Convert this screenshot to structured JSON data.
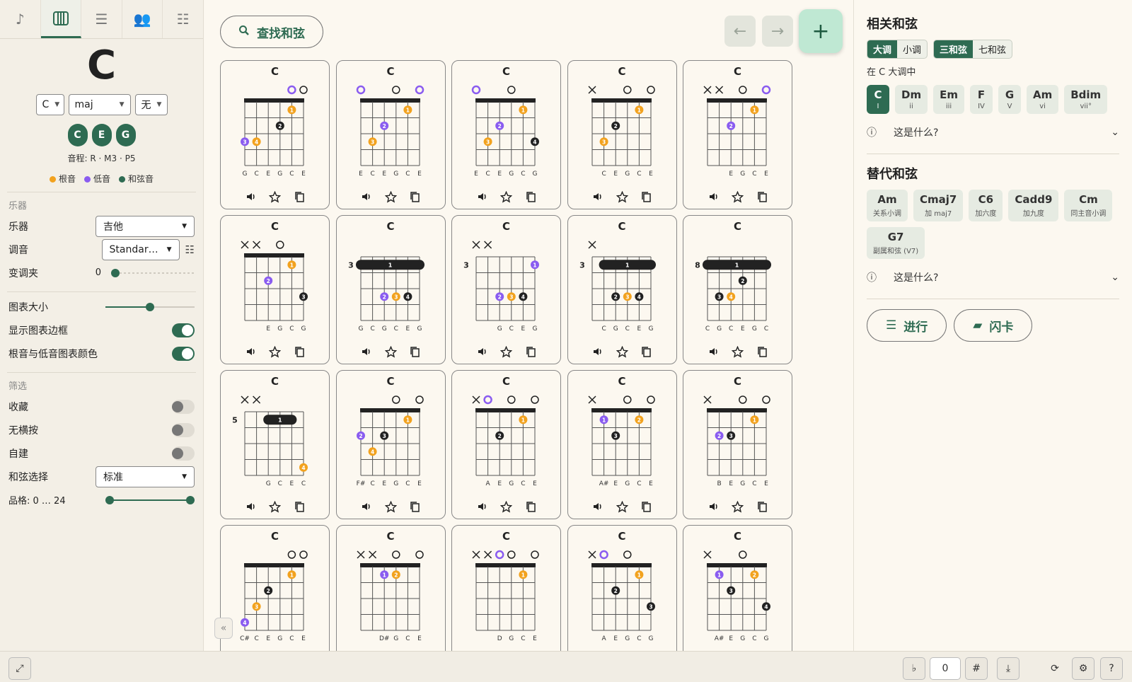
{
  "left": {
    "nav_tabs": [
      {
        "name": "note-icon"
      },
      {
        "name": "piano-icon"
      },
      {
        "name": "playlist-icon"
      },
      {
        "name": "people-icon"
      },
      {
        "name": "sliders-icon"
      }
    ],
    "chord_name": "C",
    "selectors": {
      "root": "C",
      "quality": "maj",
      "bass": "无"
    },
    "notes": [
      "C",
      "E",
      "G"
    ],
    "intervals": "音程: R · M3 · P5",
    "legend": {
      "root": "根音",
      "bass": "低音",
      "chord": "和弦音"
    },
    "instrument_section": "乐器",
    "instrument_label": "乐器",
    "instrument_value": "吉他",
    "tuning_label": "调音",
    "tuning_value": "Standar…",
    "capo_label": "变调夹",
    "capo_value": "0",
    "chart_size_label": "图表大小",
    "chart_size_level": 0.5,
    "show_border_label": "显示图表边框",
    "show_border_on": true,
    "root_bass_color_label": "根音与低音图表颜色",
    "root_bass_color_on": true,
    "filter_section": "筛选",
    "favorites_label": "收藏",
    "favorites_on": false,
    "no_barre_label": "无横按",
    "no_barre_on": false,
    "custom_label": "自建",
    "custom_on": false,
    "selection_label": "和弦选择",
    "selection_value": "标准",
    "frets_label": "品格:  0 … 24"
  },
  "center": {
    "search_label": "查找和弦",
    "add_label": "+",
    "collapse_label": "«",
    "chords": [
      {
        "title": "C",
        "pos": "",
        "top": [
          "",
          "",
          "",
          "",
          "o-root",
          "o"
        ],
        "dots": [
          [
            1,
            5,
            "root",
            "1"
          ],
          [
            2,
            4,
            "chord",
            "2"
          ],
          [
            3,
            1,
            "bass",
            "3"
          ],
          [
            3,
            2,
            "root",
            "4"
          ]
        ],
        "notes": [
          "G",
          "C",
          "E",
          "G",
          "C",
          "E"
        ]
      },
      {
        "title": "C",
        "pos": "",
        "top": [
          "o-bass",
          "",
          "",
          "o",
          "",
          "o-bass"
        ],
        "dots": [
          [
            1,
            5,
            "root",
            "1"
          ],
          [
            2,
            3,
            "bass",
            "2"
          ],
          [
            3,
            2,
            "root",
            "3"
          ]
        ],
        "notes": [
          "E",
          "C",
          "E",
          "G",
          "C",
          "E"
        ]
      },
      {
        "title": "C",
        "pos": "",
        "top": [
          "o-bass",
          "",
          "",
          "o",
          "",
          ""
        ],
        "dots": [
          [
            1,
            5,
            "root",
            "1"
          ],
          [
            2,
            3,
            "bass",
            "2"
          ],
          [
            3,
            2,
            "root",
            "3"
          ],
          [
            3,
            6,
            "chord",
            "4"
          ]
        ],
        "notes": [
          "E",
          "C",
          "E",
          "G",
          "C",
          "G"
        ]
      },
      {
        "title": "C",
        "pos": "",
        "top": [
          "x",
          "",
          "",
          "o",
          "",
          "o"
        ],
        "dots": [
          [
            1,
            5,
            "root",
            "1"
          ],
          [
            2,
            3,
            "chord",
            "2"
          ],
          [
            3,
            2,
            "root",
            "3"
          ]
        ],
        "notes": [
          "",
          "C",
          "E",
          "G",
          "C",
          "E"
        ]
      },
      {
        "title": "C",
        "pos": "",
        "top": [
          "x",
          "x",
          "",
          "o",
          "",
          "o-bass"
        ],
        "dots": [
          [
            1,
            5,
            "root",
            "1"
          ],
          [
            2,
            3,
            "bass",
            "2"
          ]
        ],
        "notes": [
          "",
          "",
          "E",
          "G",
          "C",
          "E"
        ]
      },
      {
        "title": "C",
        "pos": "",
        "top": [
          "x",
          "x",
          "",
          "o",
          "",
          ""
        ],
        "dots": [
          [
            1,
            5,
            "root",
            "1"
          ],
          [
            2,
            3,
            "bass",
            "2"
          ],
          [
            3,
            6,
            "chord",
            "3"
          ]
        ],
        "notes": [
          "",
          "",
          "E",
          "G",
          "C",
          "G"
        ]
      },
      {
        "title": "C",
        "pos": "3",
        "barre": [
          1,
          6
        ],
        "top": [
          "",
          "",
          "",
          "",
          "",
          ""
        ],
        "dots": [
          [
            3,
            3,
            "bass",
            "2"
          ],
          [
            3,
            4,
            "root",
            "3"
          ],
          [
            3,
            5,
            "chord",
            "4"
          ]
        ],
        "notes": [
          "G",
          "C",
          "G",
          "C",
          "E",
          "G"
        ]
      },
      {
        "title": "C",
        "pos": "3",
        "top": [
          "x",
          "x",
          "",
          "",
          "",
          ""
        ],
        "dots": [
          [
            1,
            6,
            "bass",
            "1"
          ],
          [
            3,
            3,
            "bass",
            "2"
          ],
          [
            3,
            4,
            "root",
            "3"
          ],
          [
            3,
            5,
            "chord",
            "4"
          ]
        ],
        "notes": [
          "",
          "",
          "G",
          "C",
          "E",
          "G"
        ]
      },
      {
        "title": "C",
        "pos": "3",
        "barre": [
          2,
          6
        ],
        "top": [
          "x",
          "",
          "",
          "",
          "",
          ""
        ],
        "dots": [
          [
            3,
            3,
            "chord",
            "2"
          ],
          [
            3,
            4,
            "root",
            "3"
          ],
          [
            3,
            5,
            "chord",
            "4"
          ]
        ],
        "notes": [
          "",
          "C",
          "G",
          "C",
          "E",
          "G"
        ]
      },
      {
        "title": "C",
        "pos": "8",
        "barre": [
          1,
          6
        ],
        "top": [
          "",
          "",
          "",
          "",
          "",
          ""
        ],
        "dots": [
          [
            2,
            4,
            "chord",
            "2"
          ],
          [
            3,
            2,
            "chord",
            "3"
          ],
          [
            3,
            3,
            "root",
            "4"
          ]
        ],
        "notes": [
          "C",
          "G",
          "C",
          "E",
          "G",
          "C"
        ]
      },
      {
        "title": "C",
        "pos": "5",
        "barre": [
          3,
          5
        ],
        "top": [
          "x",
          "x",
          "",
          "",
          "",
          ""
        ],
        "dots": [
          [
            4,
            6,
            "root",
            "4"
          ]
        ],
        "notes": [
          "",
          "",
          "G",
          "C",
          "E",
          "C"
        ]
      },
      {
        "title": "C",
        "pos": "",
        "top": [
          "",
          "",
          "",
          "o",
          "",
          "o"
        ],
        "dots": [
          [
            1,
            5,
            "root",
            "1"
          ],
          [
            2,
            1,
            "bass",
            "2"
          ],
          [
            2,
            3,
            "chord",
            "3"
          ],
          [
            3,
            2,
            "root",
            "4"
          ]
        ],
        "notes": [
          "F#",
          "C",
          "E",
          "G",
          "C",
          "E"
        ]
      },
      {
        "title": "C",
        "pos": "",
        "top": [
          "x",
          "o-bass",
          "",
          "o",
          "",
          "o"
        ],
        "dots": [
          [
            1,
            5,
            "root",
            "1"
          ],
          [
            2,
            3,
            "chord",
            "2"
          ]
        ],
        "notes": [
          "",
          "A",
          "E",
          "G",
          "C",
          "E"
        ]
      },
      {
        "title": "C",
        "pos": "",
        "top": [
          "x",
          "",
          "",
          "o",
          "",
          "o"
        ],
        "dots": [
          [
            1,
            2,
            "bass",
            "1"
          ],
          [
            1,
            5,
            "root",
            "2"
          ],
          [
            2,
            3,
            "chord",
            "3"
          ]
        ],
        "notes": [
          "",
          "A#",
          "E",
          "G",
          "C",
          "E"
        ]
      },
      {
        "title": "C",
        "pos": "",
        "top": [
          "x",
          "",
          "",
          "o",
          "",
          "o"
        ],
        "dots": [
          [
            1,
            5,
            "root",
            "1"
          ],
          [
            2,
            2,
            "bass",
            "2"
          ],
          [
            2,
            3,
            "chord",
            "3"
          ]
        ],
        "notes": [
          "",
          "B",
          "E",
          "G",
          "C",
          "E"
        ]
      },
      {
        "title": "C",
        "pos": "",
        "top": [
          "",
          "",
          "",
          "",
          "o",
          "o"
        ],
        "dots": [
          [
            1,
            5,
            "root",
            "1"
          ],
          [
            2,
            3,
            "chord",
            "2"
          ],
          [
            3,
            2,
            "root",
            "3"
          ],
          [
            4,
            1,
            "bass",
            "4"
          ]
        ],
        "notes": [
          "C#",
          "C",
          "E",
          "G",
          "C",
          "E"
        ]
      },
      {
        "title": "C",
        "pos": "",
        "top": [
          "x",
          "x",
          "",
          "o",
          "",
          "o"
        ],
        "dots": [
          [
            1,
            3,
            "bass",
            "1"
          ],
          [
            1,
            4,
            "root",
            "2"
          ]
        ],
        "notes": [
          "",
          "",
          "D#",
          "G",
          "C",
          "E"
        ]
      },
      {
        "title": "C",
        "pos": "",
        "top": [
          "x",
          "x",
          "o-bass",
          "o",
          "",
          "o"
        ],
        "dots": [
          [
            1,
            5,
            "root",
            "1"
          ]
        ],
        "notes": [
          "",
          "",
          "D",
          "G",
          "C",
          "E"
        ]
      },
      {
        "title": "C",
        "pos": "",
        "top": [
          "x",
          "o-bass",
          "",
          "o",
          "",
          ""
        ],
        "dots": [
          [
            1,
            5,
            "root",
            "1"
          ],
          [
            2,
            3,
            "chord",
            "2"
          ],
          [
            3,
            6,
            "chord",
            "3"
          ]
        ],
        "notes": [
          "",
          "A",
          "E",
          "G",
          "C",
          "G"
        ]
      },
      {
        "title": "C",
        "pos": "",
        "top": [
          "x",
          "",
          "",
          "o",
          "",
          ""
        ],
        "dots": [
          [
            1,
            2,
            "bass",
            "1"
          ],
          [
            1,
            5,
            "root",
            "2"
          ],
          [
            2,
            3,
            "chord",
            "3"
          ],
          [
            3,
            6,
            "chord",
            "4"
          ]
        ],
        "notes": [
          "",
          "A#",
          "E",
          "G",
          "C",
          "G"
        ]
      }
    ]
  },
  "right": {
    "related_title": "相关和弦",
    "mode_major": "大调",
    "mode_minor": "小调",
    "type_triad": "三和弦",
    "type_seventh": "七和弦",
    "in_key": "在 C 大调中",
    "diatonic": [
      {
        "n": "C",
        "d": "I"
      },
      {
        "n": "Dm",
        "d": "ii"
      },
      {
        "n": "Em",
        "d": "iii"
      },
      {
        "n": "F",
        "d": "IV"
      },
      {
        "n": "G",
        "d": "V"
      },
      {
        "n": "Am",
        "d": "vi"
      },
      {
        "n": "Bdim",
        "d": "vii°"
      }
    ],
    "what_label": "这是什么?",
    "alt_title": "替代和弦",
    "alternatives": [
      {
        "n": "Am",
        "d": "关系小调"
      },
      {
        "n": "Cmaj7",
        "d": "加 maj7"
      },
      {
        "n": "C6",
        "d": "加六度"
      },
      {
        "n": "Cadd9",
        "d": "加九度"
      },
      {
        "n": "Cm",
        "d": "同主音小调"
      },
      {
        "n": "G7",
        "d": "副属和弦 (V7)"
      }
    ],
    "what_label2": "这是什么?",
    "progression_label": "进行",
    "flashcard_label": "闪卡"
  },
  "bottom": {
    "flat": "♭",
    "transpose": "0",
    "sharp": "#"
  },
  "colors": {
    "accent": "#2e6b52",
    "root": "#f2a21e",
    "bass": "#8a5cf0",
    "chord": "#222222"
  }
}
